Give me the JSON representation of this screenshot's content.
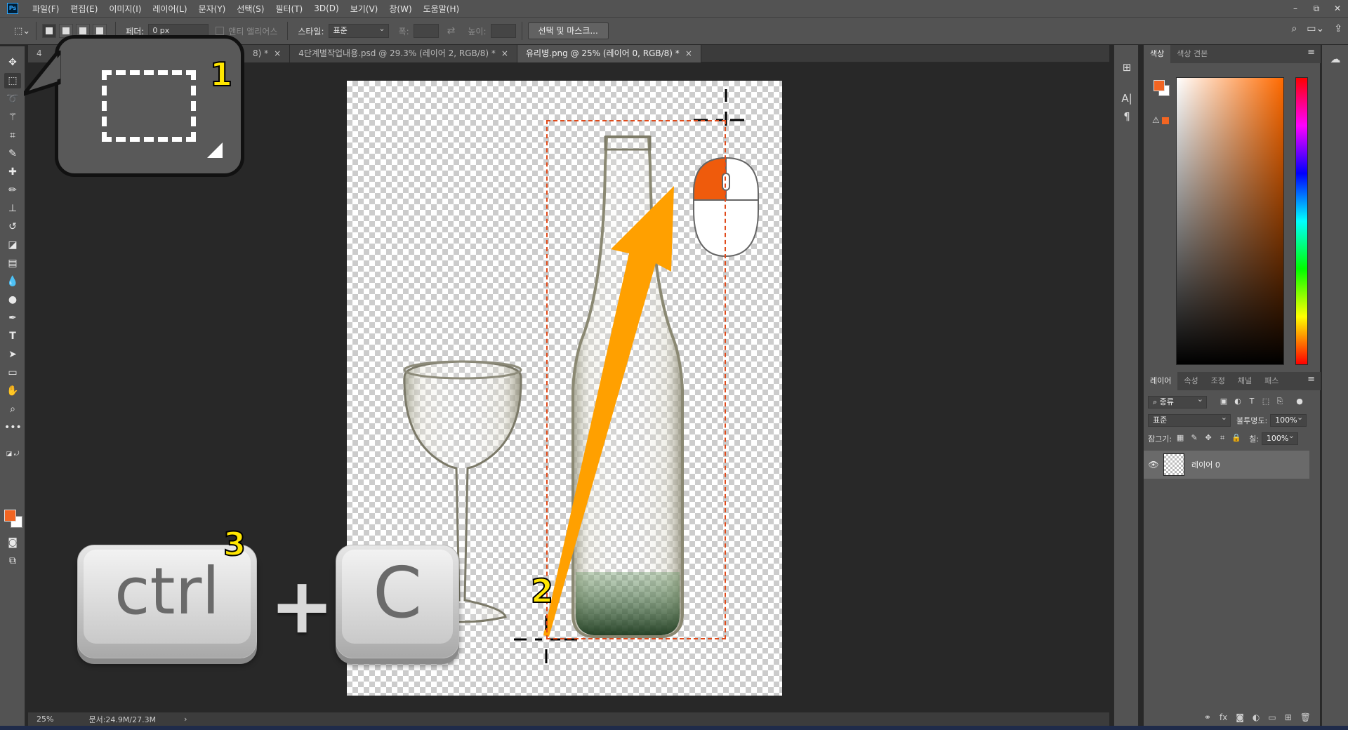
{
  "app": {
    "logo_text": "Ps"
  },
  "menubar": {
    "items": [
      "파일(F)",
      "편집(E)",
      "이미지(I)",
      "레이어(L)",
      "문자(Y)",
      "선택(S)",
      "필터(T)",
      "3D(D)",
      "보기(V)",
      "창(W)",
      "도움말(H)"
    ],
    "window_controls": [
      "–",
      "⧉",
      "✕"
    ]
  },
  "options_bar": {
    "feather_label": "페더:",
    "feather_value": "0 px",
    "anti_alias_label": "앤티 앨리어스",
    "style_label": "스타일:",
    "style_value": "표준",
    "width_label": "폭:",
    "height_label": "높이:",
    "select_mask_button": "선택 및 마스크..."
  },
  "doc_tabs": [
    {
      "label": "4",
      "close": ""
    },
    {
      "label": "8) *",
      "close": "×"
    },
    {
      "label": "4단계별작업내용.psd @ 29.3% (레이어 2, RGB/8) *",
      "close": "×"
    },
    {
      "label": "유리병.png @ 25% (레이어 0, RGB/8) *",
      "close": "×"
    }
  ],
  "status_bar": {
    "zoom": "25%",
    "doc_size": "문서:24.9M/27.3M",
    "arrow": "›"
  },
  "annotations": {
    "step1": "1",
    "step2": "2",
    "step3": "3",
    "key1": "ctrl",
    "plus": "+",
    "key2": "C"
  },
  "color_panel": {
    "tabs": [
      "색상",
      "색상 견본"
    ],
    "foreground_color": "#f26522",
    "background_color": "#ffffff"
  },
  "layers_panel": {
    "tabs": [
      "레이어",
      "속성",
      "조정",
      "채널",
      "패스"
    ],
    "filter_kind": "종류",
    "blend_mode": "표준",
    "opacity_label": "불투명도:",
    "opacity_value": "100%",
    "lock_label": "잠그기:",
    "fill_label": "칠:",
    "fill_value": "100%",
    "layers": [
      {
        "name": "레이어 0",
        "visible": true
      }
    ]
  },
  "colors": {
    "accent_orange": "#ffa000",
    "selection": "#e04a1a",
    "callout_number": "#ffe600"
  }
}
